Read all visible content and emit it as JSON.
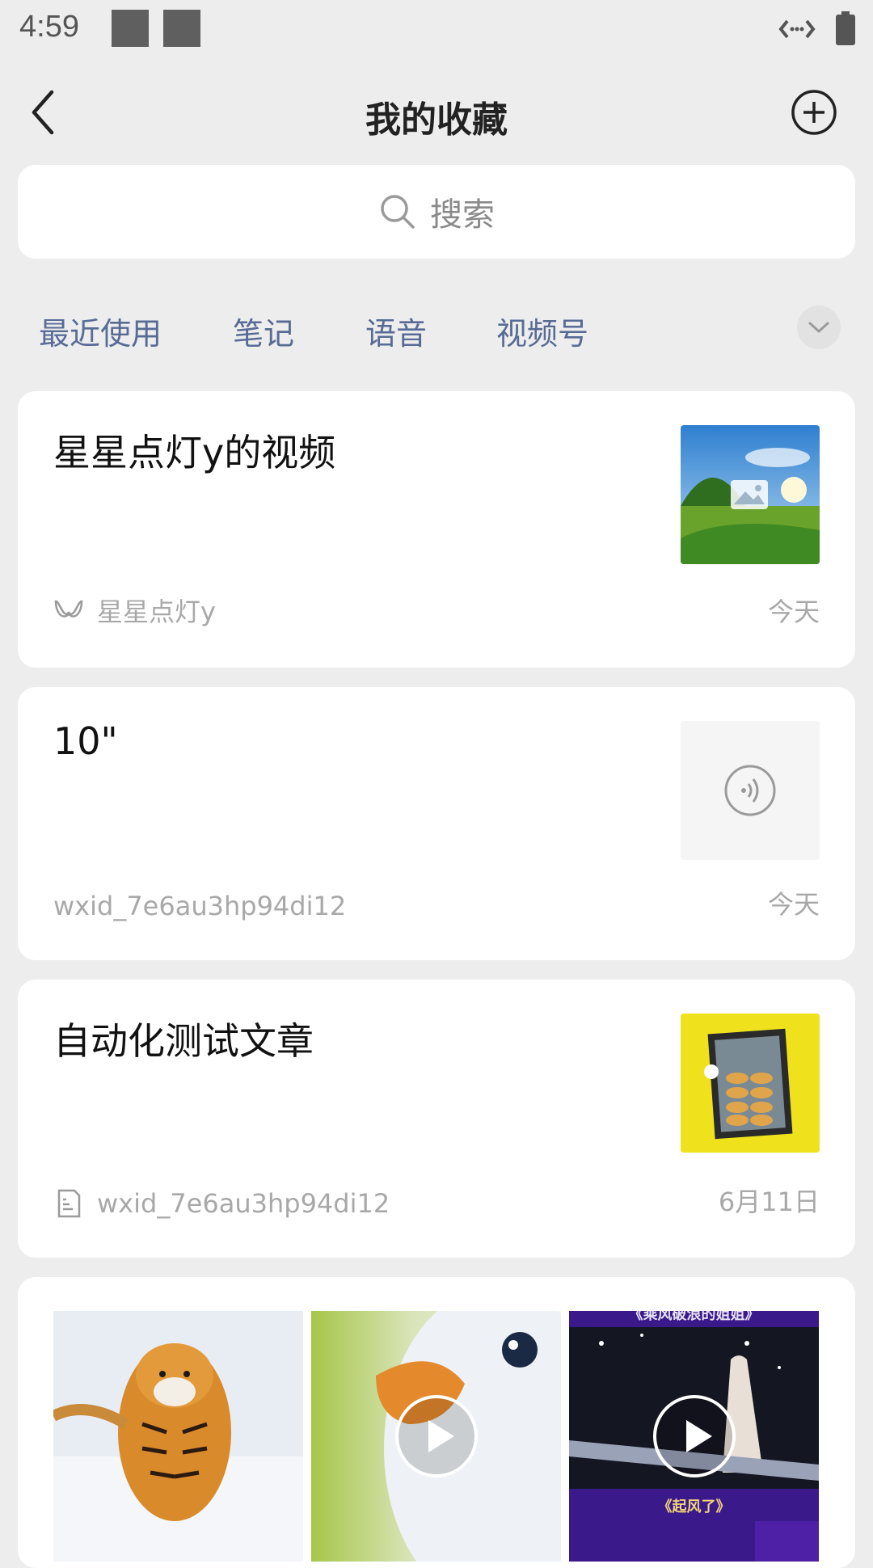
{
  "status": {
    "time": "4:59"
  },
  "nav": {
    "title": "我的收藏"
  },
  "search": {
    "placeholder": "搜索"
  },
  "tabs": [
    "最近使用",
    "笔记",
    "语音",
    "视频号"
  ],
  "items": [
    {
      "title": "星星点灯y的视频",
      "source": "星星点灯y",
      "date": "今天",
      "source_icon": "channels-icon"
    },
    {
      "title": "10\"",
      "source": "wxid_7e6au3hp94di12",
      "date": "今天",
      "thumb_icon": "voice-icon"
    },
    {
      "title": "自动化测试文章",
      "source": "wxid_7e6au3hp94di12",
      "date": "6月11日",
      "source_icon": "article-icon"
    },
    {
      "images": [
        {
          "desc_icon": "tiger-photo"
        },
        {
          "desc_icon": "duck-video",
          "caption": ""
        },
        {
          "desc_icon": "stage-video",
          "top_text": "《乘风破浪的姐姐》",
          "bottom_text": "《起风了》"
        }
      ]
    }
  ],
  "colors": {
    "accent": "#576b95",
    "background": "#ededed",
    "card": "#ffffff",
    "muted": "#a8a8a8"
  }
}
